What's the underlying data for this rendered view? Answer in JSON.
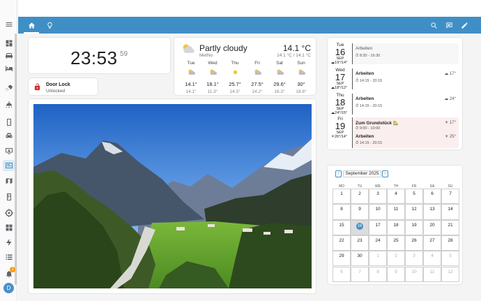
{
  "sidebar": {
    "items": [
      {
        "icon": "menu-icon"
      },
      {
        "icon": "dashboard-icon"
      },
      {
        "icon": "sofa-icon"
      },
      {
        "icon": "bed-icon"
      },
      {
        "icon": "shower-icon"
      },
      {
        "icon": "ceiling-light-icon"
      },
      {
        "icon": "door-icon"
      },
      {
        "icon": "car-icon"
      },
      {
        "icon": "monitor-icon"
      },
      {
        "icon": "calendar-view-icon"
      },
      {
        "icon": "map-icon"
      },
      {
        "icon": "fridge-icon"
      },
      {
        "icon": "clipboard-icon"
      },
      {
        "icon": "target-icon"
      },
      {
        "icon": "grid-icon"
      },
      {
        "icon": "lightning-icon"
      },
      {
        "icon": "list-icon"
      }
    ],
    "notification_count": "1",
    "avatar_initial": "D"
  },
  "topbar": {
    "tabs": [
      {
        "icon": "home-icon"
      },
      {
        "icon": "lightbulb-icon"
      }
    ],
    "actions": [
      {
        "icon": "search-icon"
      },
      {
        "icon": "assist-icon"
      },
      {
        "icon": "edit-icon"
      }
    ]
  },
  "clock": {
    "time": "23:53",
    "seconds": "59"
  },
  "door_lock": {
    "name": "Door Lock",
    "state": "Unlocked",
    "color": "#d32f2f"
  },
  "weather": {
    "condition": "Partly cloudy",
    "source": "MetNo",
    "temperature": "14.1 °C",
    "range": "14.1 °C / 14.1 °C",
    "forecast": [
      {
        "day": "Tue",
        "icon": "partly-cloudy-icon",
        "high": "14.1°",
        "low": "14.1°"
      },
      {
        "day": "Wed",
        "icon": "partly-cloudy-icon",
        "high": "18.1°",
        "low": "11.3°"
      },
      {
        "day": "Thu",
        "icon": "sunny-icon",
        "high": "25.7°",
        "low": "14.3°"
      },
      {
        "day": "Fri",
        "icon": "partly-cloudy-icon",
        "high": "27.5°",
        "low": "14.2°"
      },
      {
        "day": "Sat",
        "icon": "partly-cloudy-icon",
        "high": "29.6°",
        "low": "16.3°"
      },
      {
        "day": "Sun",
        "icon": "partly-cloudy-icon",
        "high": "30°",
        "low": "18.8°"
      }
    ]
  },
  "agenda": [
    {
      "dow": "Tue",
      "day": "16",
      "month": "SEP",
      "weather": "19°/14°",
      "events": [
        {
          "title": "Arbeiten",
          "time": "8:30 - 16:30",
          "weather": ""
        }
      ]
    },
    {
      "dow": "Wed",
      "day": "17",
      "month": "SEP",
      "weather": "18°/12°",
      "events": [
        {
          "title": "Arbeiten",
          "time": "14:15 - 20:15",
          "weather": "17°"
        }
      ]
    },
    {
      "dow": "Thu",
      "day": "18",
      "month": "SEP",
      "weather": "24°/15°",
      "events": [
        {
          "title": "Arbeiten",
          "time": "14:15 - 20:15",
          "weather": "24°"
        }
      ]
    },
    {
      "dow": "Fri",
      "day": "19",
      "month": "SEP",
      "weather": "26°/14°",
      "events": [
        {
          "title": "Zum Grundstück 🏡",
          "time": "9:00 - 10:00",
          "weather": "17°"
        },
        {
          "title": "Arbeiten",
          "time": "14:15 - 20:15",
          "weather": "25°"
        }
      ]
    }
  ],
  "calendar": {
    "month_label": "September 2025",
    "prev": "‹",
    "next": "›",
    "weekdays": [
      "MO",
      "TU",
      "WE",
      "TH",
      "FR",
      "SA",
      "SU"
    ],
    "weeks": [
      [
        "1",
        "2",
        "3",
        "4",
        "5",
        "6",
        "7"
      ],
      [
        "8",
        "9",
        "10",
        "11",
        "12",
        "13",
        "14"
      ],
      [
        "15",
        "16",
        "17",
        "18",
        "19",
        "20",
        "21"
      ],
      [
        "22",
        "23",
        "24",
        "25",
        "26",
        "27",
        "28"
      ],
      [
        "29",
        "30",
        "1",
        "2",
        "3",
        "4",
        "5"
      ],
      [
        "6",
        "7",
        "8",
        "9",
        "10",
        "11",
        "12"
      ]
    ],
    "today": "16"
  },
  "colors": {
    "accent": "#3f8fc6",
    "lock_open": "#d32f2f"
  }
}
